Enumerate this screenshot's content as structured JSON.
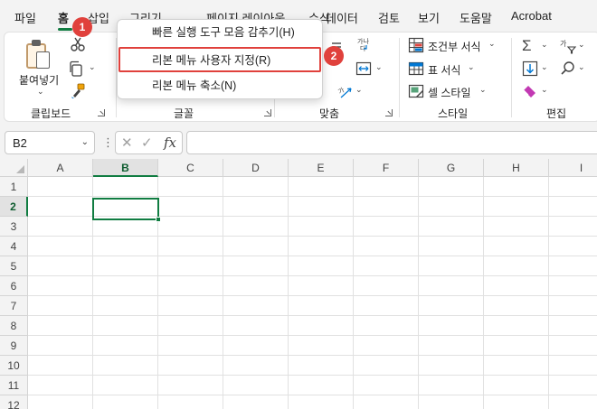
{
  "tabs": [
    {
      "label": "파일",
      "active": false
    },
    {
      "label": "홈",
      "active": true
    },
    {
      "label": "삽입",
      "active": false
    },
    {
      "label": "그리기",
      "active": false
    },
    {
      "label": "페이지 레이아웃",
      "active": false
    },
    {
      "label": "수식",
      "active": false
    },
    {
      "label": "데이터",
      "active": false
    },
    {
      "label": "검토",
      "active": false
    },
    {
      "label": "보기",
      "active": false
    },
    {
      "label": "도움말",
      "active": false
    },
    {
      "label": "Acrobat",
      "active": false
    }
  ],
  "ribbon": {
    "paste_label": "붙여넣기",
    "groups": {
      "clipboard": "클립보드",
      "font": "글꼴",
      "alignment": "맞춤",
      "styles": "스타일",
      "editing": "편집"
    },
    "styles": {
      "conditional_format": "조건부 서식",
      "table_format": "표 서식",
      "cell_styles": "셀 스타일"
    }
  },
  "context_menu": {
    "items": [
      {
        "label": "빠른 실행 도구 모음 감추기(H)"
      },
      {
        "label": "리본 메뉴 사용자 지정(R)"
      },
      {
        "label": "리본 메뉴 축소(N)"
      }
    ]
  },
  "badges": [
    "1",
    "2"
  ],
  "formula_bar": {
    "name_box": "B2",
    "fx": "fx"
  },
  "sheet": {
    "columns": [
      "A",
      "B",
      "C",
      "D",
      "E",
      "F",
      "G",
      "H",
      "I"
    ],
    "rows": [
      "1",
      "2",
      "3",
      "4",
      "5",
      "6",
      "7",
      "8",
      "9",
      "10",
      "11",
      "12"
    ],
    "selected_column": "B",
    "selected_row": "2"
  },
  "colors": {
    "accent": "#107c41",
    "highlight": "#e0413c"
  }
}
